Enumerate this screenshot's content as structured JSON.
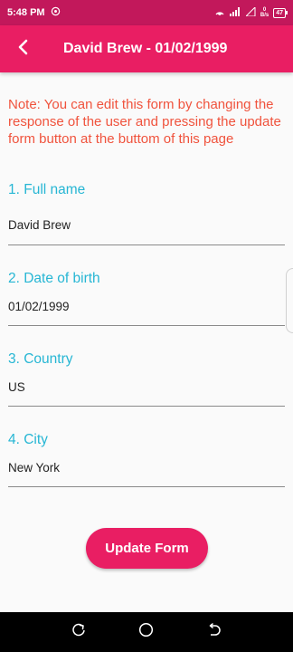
{
  "status_bar": {
    "time": "5:48 PM",
    "net_speed_value": "0",
    "net_speed_unit": "B/s",
    "battery": "47"
  },
  "app_bar": {
    "title": "David Brew - 01/02/1999",
    "back_icon": "arrow-left-icon"
  },
  "note": "Note: You can edit this form by changing the response of the user and pressing the update form button at the buttom of this page",
  "fields": [
    {
      "label": "1. Full name",
      "value": "David Brew"
    },
    {
      "label": "2. Date of birth",
      "value": "01/02/1999"
    },
    {
      "label": "3. Country",
      "value": "US"
    },
    {
      "label": "4. City",
      "value": "New York"
    }
  ],
  "update_button": "Update Form",
  "colors": {
    "status_bar": "#c2185b",
    "app_bar": "#e91e63",
    "note_text": "#f0533d",
    "field_label": "#26b6d4",
    "button": "#e91e63"
  }
}
